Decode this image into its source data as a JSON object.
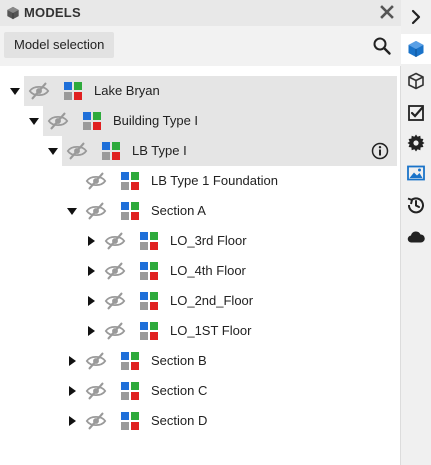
{
  "header": {
    "title": "MODELS",
    "title_icon": "cube-icon",
    "close_icon": "close-icon"
  },
  "toolbar": {
    "model_selection_label": "Model selection",
    "search_icon": "search-icon"
  },
  "tree": [
    {
      "label": "Lake Bryan",
      "depth": 0,
      "expanded": true,
      "has_children": true
    },
    {
      "label": "Building Type I",
      "depth": 1,
      "expanded": true,
      "has_children": true
    },
    {
      "label": "LB Type I",
      "depth": 2,
      "expanded": true,
      "has_children": true,
      "info": true
    },
    {
      "label": "LB Type 1 Foundation",
      "depth": 3,
      "expanded": false,
      "has_children": false
    },
    {
      "label": "Section A",
      "depth": 3,
      "expanded": true,
      "has_children": true
    },
    {
      "label": "LO_3rd Floor",
      "depth": 4,
      "expanded": false,
      "has_children": true
    },
    {
      "label": "LO_4th Floor",
      "depth": 4,
      "expanded": false,
      "has_children": true
    },
    {
      "label": "LO_2nd_Floor",
      "depth": 4,
      "expanded": false,
      "has_children": true
    },
    {
      "label": "LO_1ST Floor",
      "depth": 4,
      "expanded": false,
      "has_children": true
    },
    {
      "label": "Section B",
      "depth": 3,
      "expanded": false,
      "has_children": true
    },
    {
      "label": "Section C",
      "depth": 3,
      "expanded": false,
      "has_children": true
    },
    {
      "label": "Section D",
      "depth": 3,
      "expanded": false,
      "has_children": true
    }
  ],
  "siderail": [
    {
      "icon": "chevron-right-icon",
      "active": false
    },
    {
      "icon": "cube-icon",
      "active": true,
      "color": "#1a73c9"
    },
    {
      "icon": "cube-outline-icon",
      "active": false
    },
    {
      "icon": "checklist-icon",
      "active": false
    },
    {
      "icon": "gear-icon",
      "active": false
    },
    {
      "icon": "image-icon",
      "active": false,
      "color": "#1a73c9"
    },
    {
      "icon": "history-icon",
      "active": false
    },
    {
      "icon": "cloud-icon",
      "active": false
    }
  ],
  "colors": {
    "accent": "#1a73c9",
    "selected_row": "#e5e5e5",
    "model_blue": "#1e6fd9",
    "model_green": "#2eaa3c",
    "model_red": "#e02020",
    "model_gray": "#9a9a9a"
  }
}
